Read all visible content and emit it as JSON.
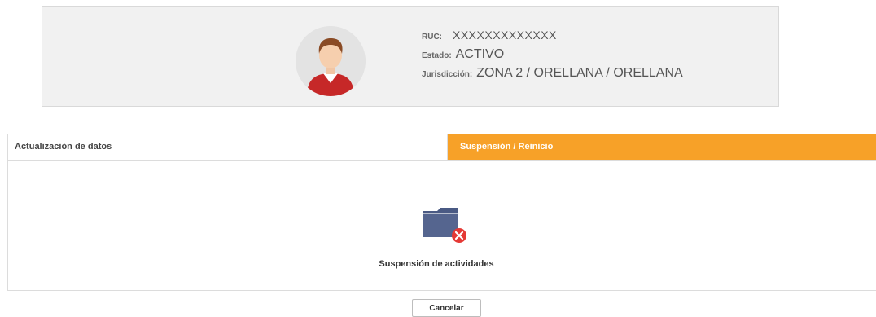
{
  "profile": {
    "ruc_label": "RUC:",
    "ruc_value": "XXXXXXXXXXXXX",
    "estado_label": "Estado:",
    "estado_value": "ACTIVO",
    "jurisdiccion_label": "Jurisdicción:",
    "jurisdiccion_value": "ZONA 2 / ORELLANA / ORELLANA",
    "avatar_icon": "user-avatar-icon"
  },
  "tabs": [
    {
      "label": "Actualización de datos",
      "active": false
    },
    {
      "label": "Suspensión / Reinicio",
      "active": true
    }
  ],
  "panel": {
    "icon": "folder-remove-icon",
    "option_label": "Suspensión de actividades"
  },
  "actions": {
    "cancel_label": "Cancelar"
  },
  "colors": {
    "active_tab": "#f7a128",
    "folder": "#4a5a84",
    "remove_badge": "#e53935"
  }
}
